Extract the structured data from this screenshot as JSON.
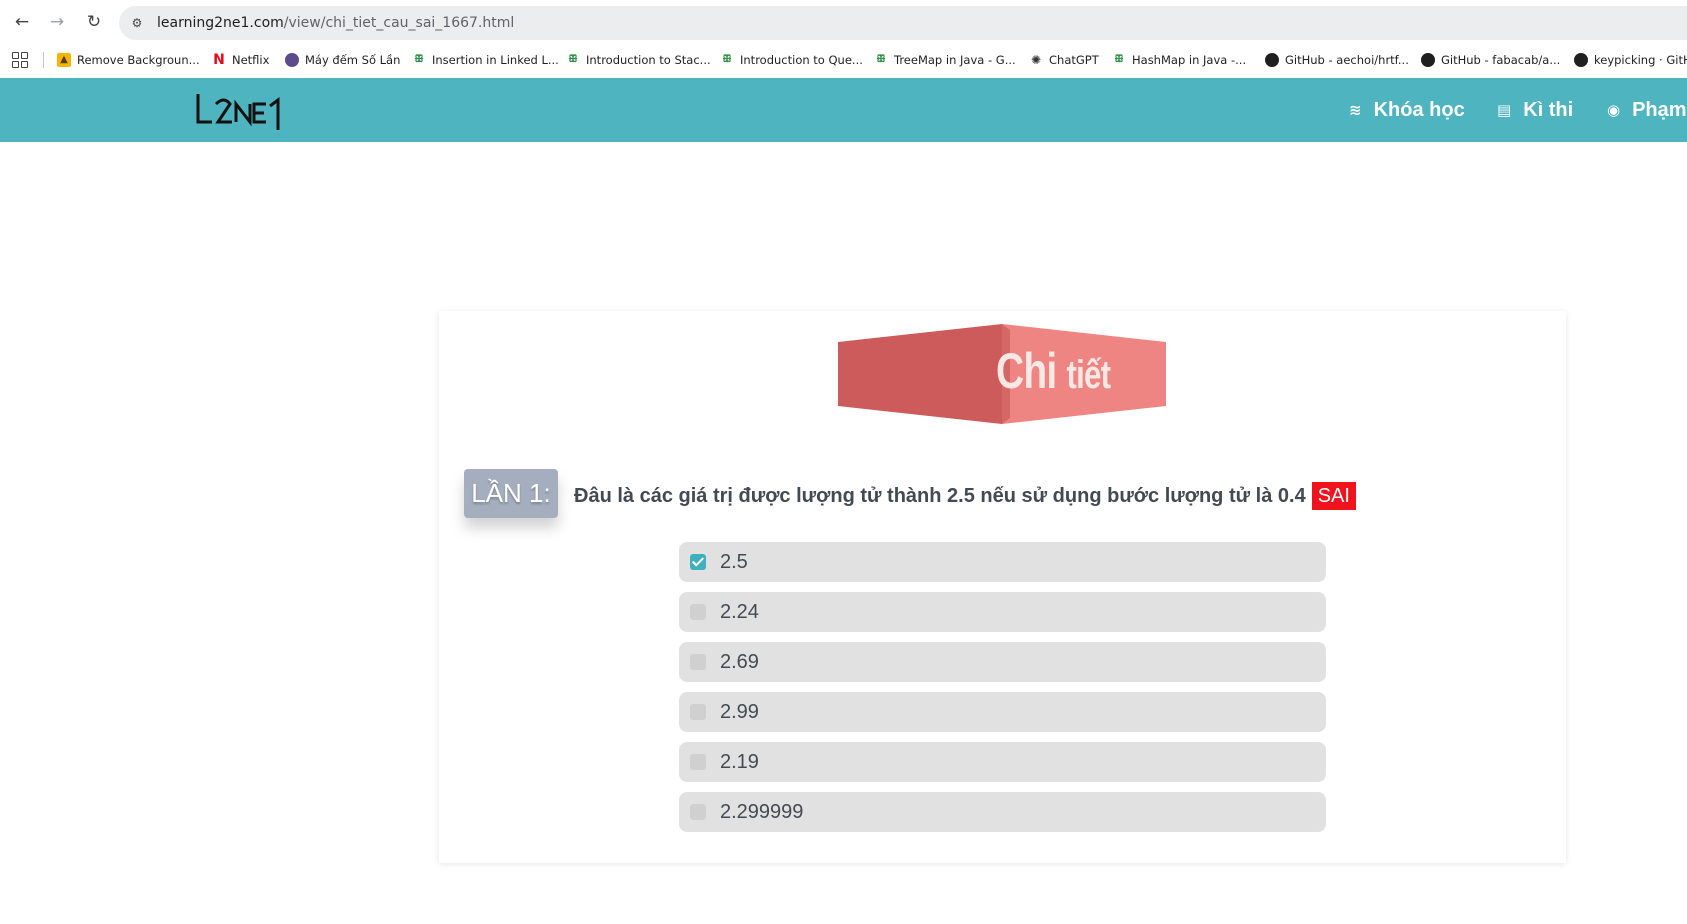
{
  "browser": {
    "url_host": "learning2ne1.com",
    "url_path": "/view/chi_tiet_cau_sai_1667.html",
    "bookmarks": [
      {
        "label": "Remove Backgroun...",
        "icon": "remove-bg-icon"
      },
      {
        "label": "Netflix",
        "icon": "netflix-icon"
      },
      {
        "label": "Máy đếm Số Lần",
        "icon": "counter-icon"
      },
      {
        "label": "Insertion in Linked L...",
        "icon": "gfg-icon"
      },
      {
        "label": "Introduction to Stac...",
        "icon": "gfg-icon"
      },
      {
        "label": "Introduction to Que...",
        "icon": "gfg-icon"
      },
      {
        "label": "TreeMap in Java - G...",
        "icon": "gfg-icon"
      },
      {
        "label": "ChatGPT",
        "icon": "chatgpt-icon"
      },
      {
        "label": "HashMap in Java -...",
        "icon": "gfg-icon"
      },
      {
        "label": "GitHub - aechoi/hrtf...",
        "icon": "github-icon"
      },
      {
        "label": "GitHub - fabacab/a...",
        "icon": "github-icon"
      },
      {
        "label": "keypicking · GitHu",
        "icon": "github-icon"
      }
    ]
  },
  "header": {
    "logo_text": "L2NE1",
    "menu": [
      {
        "label": "Khóa học",
        "icon": "layers-icon"
      },
      {
        "label": "Kì thi",
        "icon": "document-icon"
      },
      {
        "label": "Phạm",
        "icon": "user-circle-icon"
      }
    ],
    "accent_color": "#4db4c0"
  },
  "detail": {
    "banner_title": "Chi",
    "banner_title_small": "tiết",
    "attempt_label": "LẦN 1:",
    "question": "Đâu là các giá trị được lượng tử thành 2.5 nếu sử dụng bước lượng tử là 0.4",
    "result": "SAI",
    "result_color": "#f0131e",
    "options": [
      {
        "label": "2.5",
        "checked": true
      },
      {
        "label": "2.24",
        "checked": false
      },
      {
        "label": "2.69",
        "checked": false
      },
      {
        "label": "2.99",
        "checked": false
      },
      {
        "label": "2.19",
        "checked": false
      },
      {
        "label": "2.299999",
        "checked": false
      }
    ]
  }
}
